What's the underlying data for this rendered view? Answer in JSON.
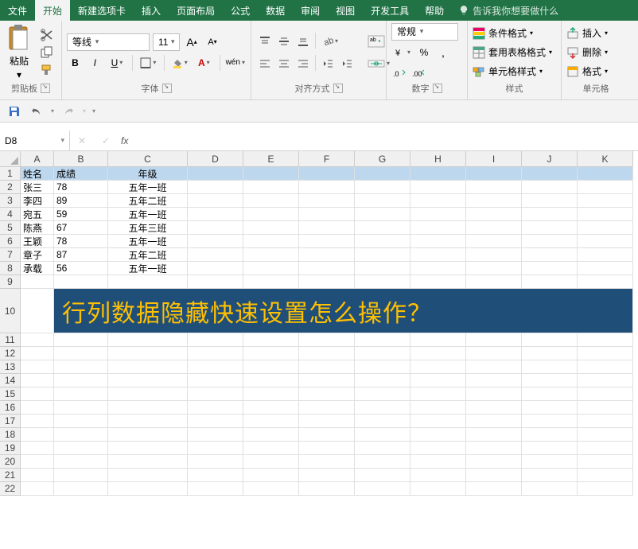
{
  "menu": {
    "tabs": [
      "文件",
      "开始",
      "新建选项卡",
      "插入",
      "页面布局",
      "公式",
      "数据",
      "审阅",
      "视图",
      "开发工具",
      "帮助"
    ],
    "active_index": 1,
    "tell_me": "告诉我你想要做什么"
  },
  "ribbon": {
    "clipboard": {
      "paste": "粘贴",
      "label": "剪贴板"
    },
    "font": {
      "name": "等线",
      "size": "11",
      "increase": "A",
      "decrease": "A",
      "bold": "B",
      "italic": "I",
      "underline": "U",
      "phonetic": "wén",
      "label": "字体"
    },
    "alignment": {
      "label": "对齐方式"
    },
    "number": {
      "format": "常规",
      "label": "数字"
    },
    "styles": {
      "cond": "条件格式",
      "table": "套用表格格式",
      "cell": "单元格样式",
      "label": "样式"
    },
    "cells": {
      "insert": "插入",
      "delete": "删除",
      "format": "格式",
      "label": "单元格"
    }
  },
  "namebox": "D8",
  "fx": "fx",
  "columns": [
    "A",
    "B",
    "C",
    "D",
    "E",
    "F",
    "G",
    "H",
    "I",
    "J",
    "K"
  ],
  "rows": [
    "1",
    "2",
    "3",
    "4",
    "5",
    "6",
    "7",
    "8",
    "9",
    "10",
    "11",
    "12",
    "13",
    "14",
    "15",
    "16",
    "17",
    "18",
    "19",
    "20",
    "21",
    "22"
  ],
  "header_row": {
    "name": "姓名",
    "score": "成绩",
    "grade": "年级"
  },
  "data": [
    {
      "name": "张三",
      "score": "78",
      "grade": "五年一班"
    },
    {
      "name": "李四",
      "score": "89",
      "grade": "五年二班"
    },
    {
      "name": "宛五",
      "score": "59",
      "grade": "五年一班"
    },
    {
      "name": "陈燕",
      "score": "67",
      "grade": "五年三班"
    },
    {
      "name": "王颖",
      "score": "78",
      "grade": "五年一班"
    },
    {
      "name": "章子",
      "score": "87",
      "grade": "五年二班"
    },
    {
      "name": "承载",
      "score": "56",
      "grade": "五年一班"
    }
  ],
  "banner": "行列数据隐藏快速设置怎么操作？",
  "col_widths": {
    "A": 42,
    "B": 68,
    "C": 100,
    "D": 70,
    "E": 70,
    "F": 70,
    "G": 70,
    "H": 70,
    "I": 70,
    "J": 70,
    "K": 70
  }
}
